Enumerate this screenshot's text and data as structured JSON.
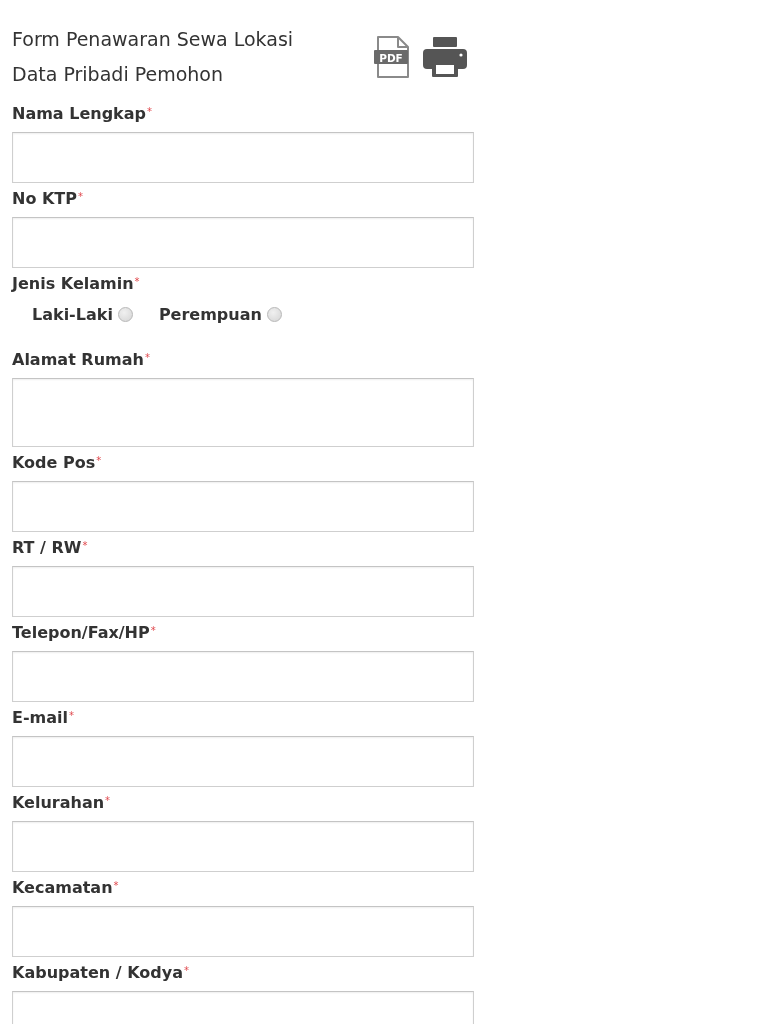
{
  "header": {
    "title": "Form Penawaran Sewa Lokasi",
    "subtitle": "Data Pribadi Pemohon"
  },
  "actions": [
    {
      "kind": "pdf",
      "text": "PDF"
    },
    {
      "kind": "print"
    }
  ],
  "fields": [
    {
      "kind": "input",
      "label": "Nama Lengkap",
      "required_mark": "*"
    },
    {
      "kind": "input",
      "label": "No KTP",
      "required_mark": "*"
    },
    {
      "kind": "radio",
      "label": "Jenis Kelamin",
      "required_mark": "*",
      "options": [
        {
          "label": "Laki-Laki",
          "selected": false
        },
        {
          "label": "Perempuan",
          "selected": false
        }
      ]
    },
    {
      "kind": "textarea",
      "label": "Alamat Rumah",
      "required_mark": "*"
    },
    {
      "kind": "input",
      "label": "Kode Pos",
      "required_mark": "*"
    },
    {
      "kind": "input",
      "label": "RT / RW",
      "required_mark": "*"
    },
    {
      "kind": "input",
      "label": "Telepon/Fax/HP",
      "required_mark": "*"
    },
    {
      "kind": "input",
      "label": "E-mail",
      "required_mark": "*"
    },
    {
      "kind": "input",
      "label": "Kelurahan",
      "required_mark": "*"
    },
    {
      "kind": "input",
      "label": "Kecamatan",
      "required_mark": "*"
    },
    {
      "kind": "input",
      "label": "Kabupaten / Kodya",
      "required_mark": "*"
    }
  ]
}
